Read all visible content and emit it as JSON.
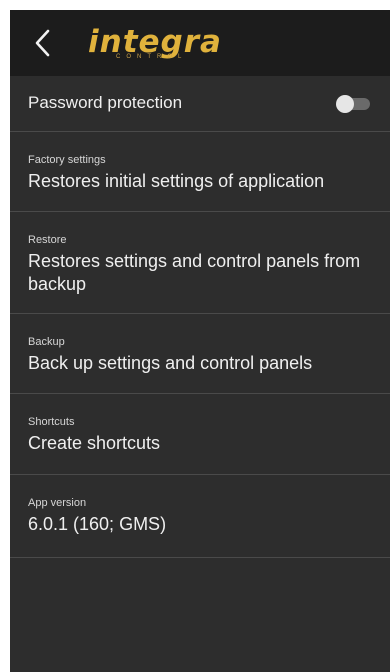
{
  "header": {
    "back_icon": "chevron-left-icon",
    "logo_text": "integra",
    "logo_subtext": "CONTROL",
    "logo_color": "#e0b23c"
  },
  "settings": {
    "password_protection": {
      "title": "Password protection",
      "enabled": false
    },
    "factory": {
      "label": "Factory settings",
      "value": "Restores initial settings of application"
    },
    "restore": {
      "label": "Restore",
      "value": "Restores settings and control panels from backup"
    },
    "backup": {
      "label": "Backup",
      "value": "Back up settings and control panels"
    },
    "shortcuts": {
      "label": "Shortcuts",
      "value": "Create shortcuts"
    },
    "version": {
      "label": "App version",
      "value": "6.0.1 (160; GMS)"
    }
  },
  "colors": {
    "background": "#2d2d2d",
    "appbar": "#1c1c1c",
    "divider": "#4a4a4a",
    "text": "#efefef"
  }
}
